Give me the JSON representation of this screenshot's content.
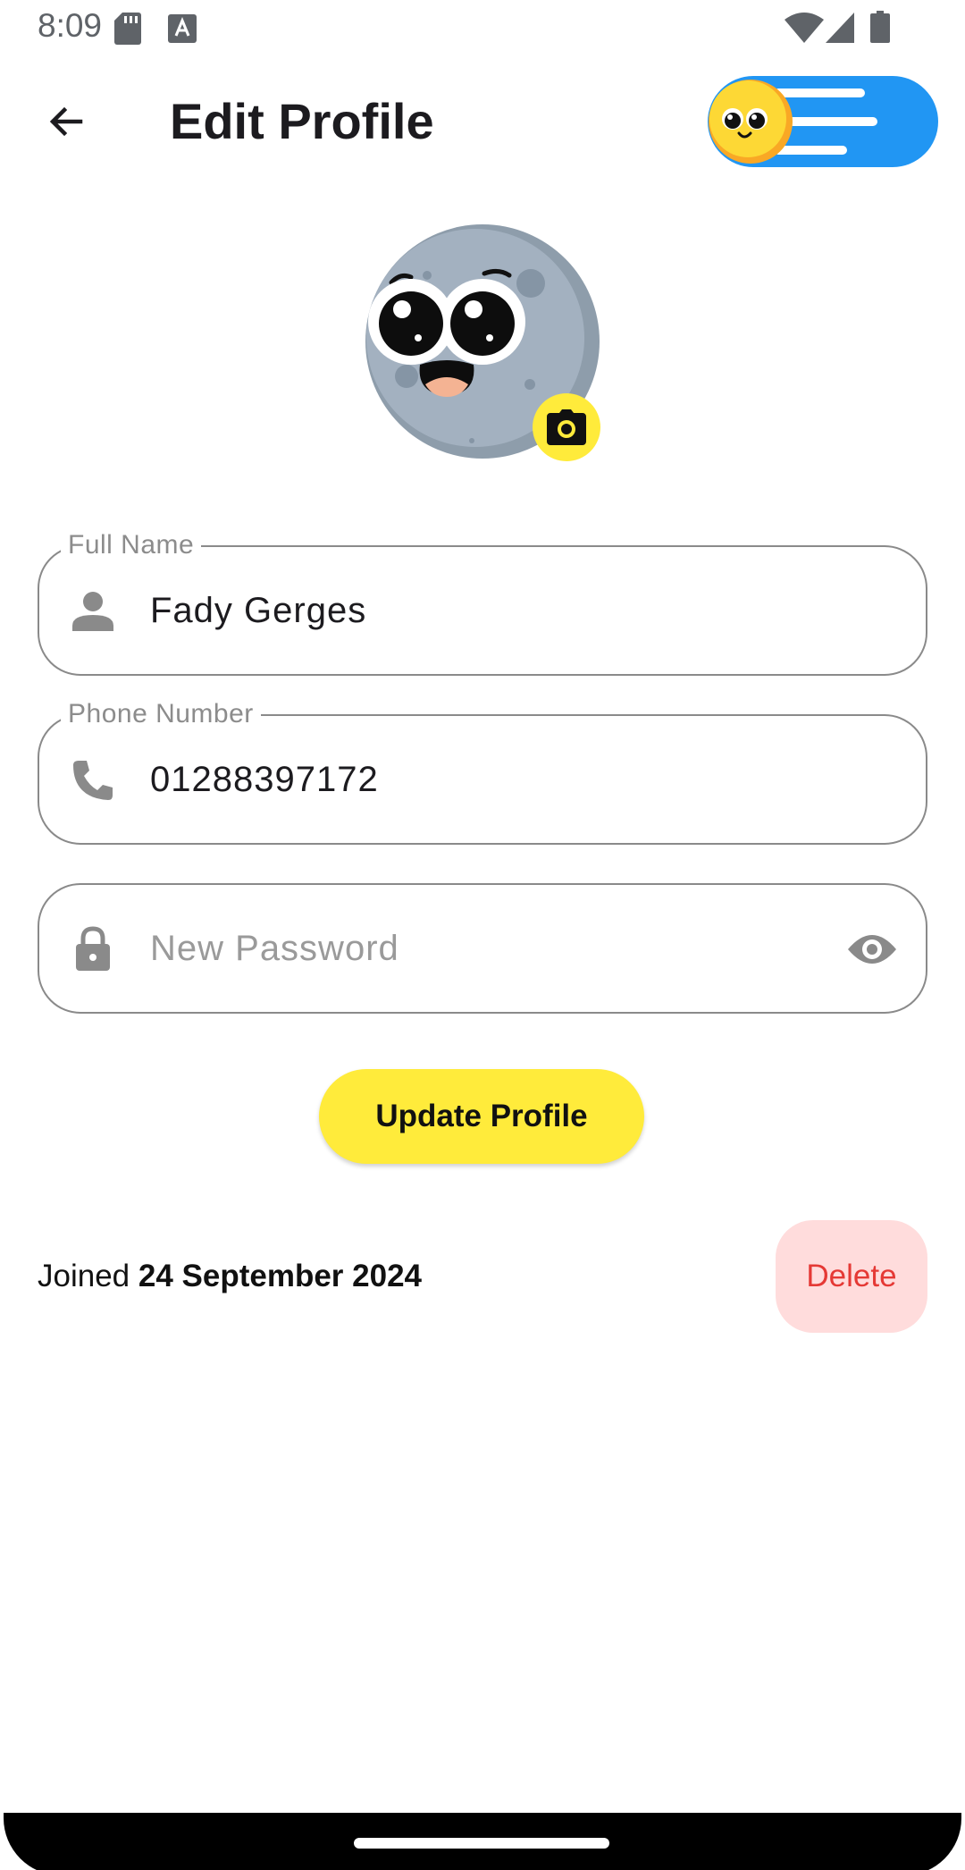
{
  "status_bar": {
    "time": "8:09",
    "icons": [
      "sd-card-icon",
      "keyboard-a-icon",
      "wifi-icon",
      "signal-icon",
      "battery-icon"
    ]
  },
  "app_bar": {
    "title": "Edit Profile",
    "back_icon": "arrow-back-icon",
    "theme_toggle_icon": "emoji-theme-toggle-icon"
  },
  "avatar": {
    "image": "moon-emoji-avatar",
    "camera_icon": "camera-icon"
  },
  "form": {
    "full_name": {
      "label": "Full Name",
      "value": "Fady Gerges",
      "icon": "person-icon"
    },
    "phone": {
      "label": "Phone Number",
      "value": "01288397172",
      "icon": "phone-icon"
    },
    "password": {
      "placeholder": "New Password",
      "value": "",
      "icon": "lock-icon",
      "toggle_icon": "eye-icon"
    }
  },
  "update_button": "Update Profile",
  "joined": {
    "prefix": "Joined",
    "date": "24 September 2024"
  },
  "delete_button": "Delete",
  "colors": {
    "accent_yellow": "#ffeb3b",
    "toggle_blue": "#2196f3",
    "delete_bg": "#ffdcdc",
    "delete_text": "#e53935",
    "outline": "#8a8a8a"
  }
}
